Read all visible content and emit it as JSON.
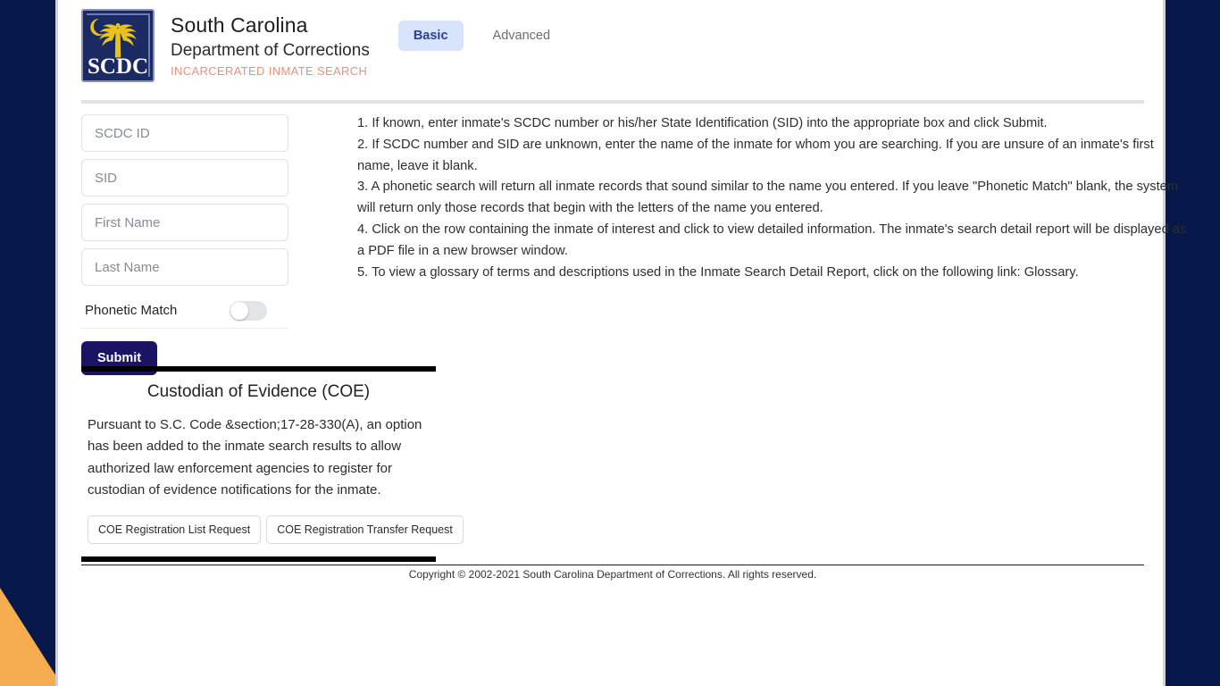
{
  "brand": {
    "logo_icon": "scdc-palmetto-logo",
    "logo_text": "SCDC",
    "line1": "South Carolina",
    "line2": "Department of Corrections",
    "line3": "INCARCERATED INMATE SEARCH"
  },
  "tabs": {
    "basic": "Basic",
    "advanced": "Advanced",
    "active": "Basic"
  },
  "search_form": {
    "scdc_id": {
      "value": "",
      "placeholder": "SCDC ID"
    },
    "sid": {
      "value": "",
      "placeholder": "SID"
    },
    "first_name": {
      "value": "",
      "placeholder": "First Name"
    },
    "last_name": {
      "value": "",
      "placeholder": "Last Name"
    },
    "phonetic_match_label": "Phonetic Match",
    "phonetic_match_state": "off",
    "submit_label": "Submit"
  },
  "instructions": {
    "item1": "1. If known, enter inmate's SCDC number or his/her State Identification (SID) into the appropriate box and click Submit.",
    "item2": "2. If SCDC number and SID are unknown, enter the name of the inmate for whom you are searching. If you are unsure of an inmate's first name, leave it blank.",
    "item3": "3. A phonetic search will return all inmate records that sound similar to the name you entered. If you leave \"Phonetic Match\" blank, the system will return only those records that begin with the letters of the name you entered.",
    "item4": "4. Click on the row containing the inmate of interest and click to view detailed information. The inmate's search detail report will be displayed as a PDF file in a new browser window.",
    "item5": "5. To view a glossary of terms and descriptions used in the Inmate Search Detail Report, click on the following link: Glossary."
  },
  "coe": {
    "title": "Custodian of Evidence (COE)",
    "body": "Pursuant to S.C. Code &section;17-28-330(A), an option has been added to the inmate search results to allow authorized law enforcement agencies to register for custodian of evidence notifications for the inmate.",
    "list_request_label": "COE Registration List Request",
    "transfer_request_label": "COE Registration Transfer Request"
  },
  "footer": {
    "copyright": "Copyright © 2002-2021 South Carolina Department of Corrections. All rights reserved."
  },
  "colors": {
    "page_background": "#06184a",
    "accent_orange": "#f5ac4e",
    "submit_button": "#1b1464",
    "active_tab_background": "#d7e4fb",
    "active_tab_text": "#2f3f92",
    "tagline": "#e8927c",
    "logo_gold": "#e8c221",
    "logo_navy": "#1b2a63"
  }
}
